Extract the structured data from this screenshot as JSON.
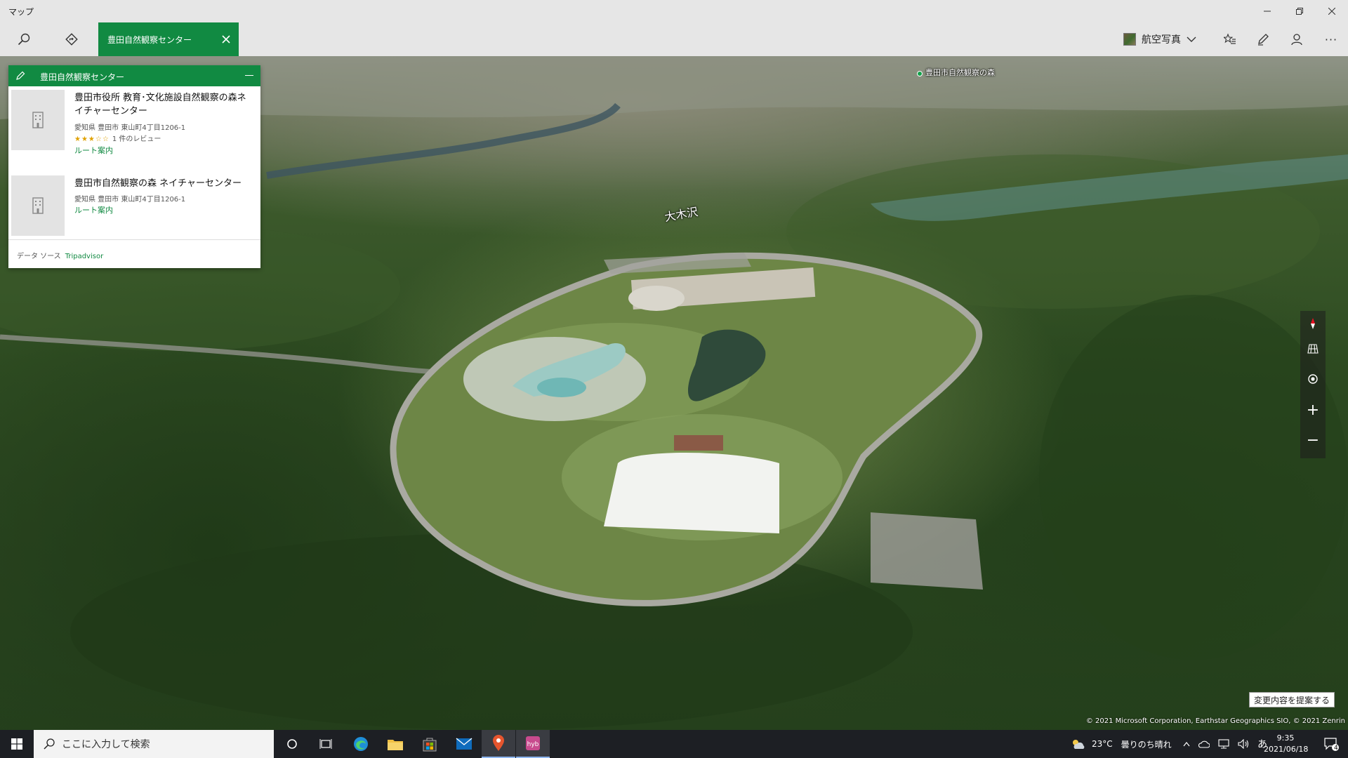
{
  "app": {
    "title": "マップ"
  },
  "window_controls": {
    "minimize_icon": "minimize-icon",
    "maximize_icon": "restore-icon",
    "close_icon": "close-icon"
  },
  "toolbar": {
    "search_icon": "search-icon",
    "directions_icon": "directions-icon",
    "search_tab_label": "豊田自然観察センター",
    "layer_label": "航空写真",
    "favorites_icon": "favorites-icon",
    "ink_icon": "pen-icon",
    "account_icon": "person-icon",
    "more_label": "···"
  },
  "map": {
    "labels": [
      {
        "text": "豊田市自然観察の森"
      },
      {
        "text": "大木沢"
      }
    ],
    "suggest_button": "変更内容を提案する",
    "copyright": "© 2021 Microsoft Corporation, Earthstar Geographics SIO, © 2021 Zenrin"
  },
  "panel": {
    "title": "豊田自然観察センター",
    "results": [
      {
        "name": "豊田市役所 教育･文化施設自然観察の森ネイチャーセンター",
        "address": "愛知県 豊田市 東山町4丁目1206-1",
        "rating": 3,
        "rating_stars": "★★★☆☆",
        "reviews": "1 件のレビュー",
        "route": "ルート案内"
      },
      {
        "name": "豊田市自然観察の森 ネイチャーセンター",
        "address": "愛知県 豊田市 東山町4丁目1206-1",
        "route": "ルート案内"
      }
    ],
    "footer_label": "データ ソース",
    "footer_source": "Tripadvisor"
  },
  "map_controls": {
    "compass_icon": "compass-icon",
    "grid_icon": "grid-view-icon",
    "locate_icon": "locate-icon",
    "zoom_in": "+",
    "zoom_out": "−"
  },
  "taskbar": {
    "search_placeholder": "ここに入力して検索",
    "apps": [
      "cortana",
      "task-view",
      "edge",
      "file-explorer",
      "store",
      "mail",
      "maps",
      "hyb"
    ],
    "weather_temp": "23°C",
    "weather_text": "曇りのち晴れ",
    "ime": "あ",
    "time": "9:35",
    "date": "2021/06/18",
    "notification_count": "4"
  }
}
